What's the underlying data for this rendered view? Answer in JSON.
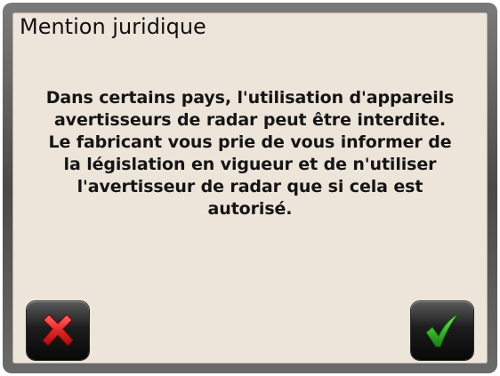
{
  "dialog": {
    "title": "Mention juridique",
    "message": "Dans certains pays, l'utilisation d'appareils\navertisseurs de radar peut être interdite.\nLe fabricant vous prie de vous informer de\nla législation en vigueur et de n'utiliser\nl'avertisseur de radar que si cela est\nautorisé."
  },
  "buttons": {
    "cancel": {
      "icon": "close-icon",
      "color": "#e02828"
    },
    "confirm": {
      "icon": "checkmark-icon",
      "color": "#3dbb2c"
    }
  },
  "colors": {
    "background": "#ede4da",
    "frame": "#5a5a5a"
  }
}
